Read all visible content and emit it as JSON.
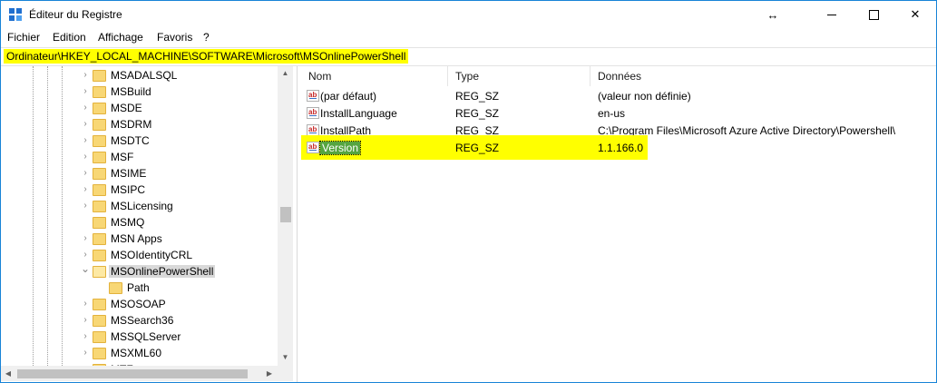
{
  "window": {
    "title": "Éditeur du Registre",
    "controls": {
      "resize_glyph": "↔",
      "minimize": "—",
      "maximize": "☐",
      "close": "✕"
    }
  },
  "menu": [
    "Fichier",
    "Edition",
    "Affichage",
    "Favoris",
    "?"
  ],
  "address": "Ordinateur\\HKEY_LOCAL_MACHINE\\SOFTWARE\\Microsoft\\MSOnlinePowerShell",
  "tree": {
    "items": [
      {
        "label": "MSADALSQL",
        "expandable": true,
        "state": "collapsed"
      },
      {
        "label": "MSBuild",
        "expandable": true,
        "state": "collapsed"
      },
      {
        "label": "MSDE",
        "expandable": true,
        "state": "collapsed"
      },
      {
        "label": "MSDRM",
        "expandable": true,
        "state": "collapsed"
      },
      {
        "label": "MSDTC",
        "expandable": true,
        "state": "collapsed"
      },
      {
        "label": "MSF",
        "expandable": true,
        "state": "collapsed"
      },
      {
        "label": "MSIME",
        "expandable": true,
        "state": "collapsed"
      },
      {
        "label": "MSIPC",
        "expandable": true,
        "state": "collapsed"
      },
      {
        "label": "MSLicensing",
        "expandable": true,
        "state": "collapsed"
      },
      {
        "label": "MSMQ",
        "expandable": false,
        "state": "leaf"
      },
      {
        "label": "MSN Apps",
        "expandable": true,
        "state": "collapsed"
      },
      {
        "label": "MSOIdentityCRL",
        "expandable": true,
        "state": "collapsed"
      },
      {
        "label": "MSOnlinePowerShell",
        "expandable": true,
        "state": "expanded",
        "selected": true
      },
      {
        "label": "Path",
        "expandable": false,
        "state": "leaf",
        "child": true
      },
      {
        "label": "MSOSOAP",
        "expandable": true,
        "state": "collapsed"
      },
      {
        "label": "MSSearch36",
        "expandable": true,
        "state": "collapsed"
      },
      {
        "label": "MSSQLServer",
        "expandable": true,
        "state": "collapsed"
      },
      {
        "label": "MSXML60",
        "expandable": true,
        "state": "collapsed"
      },
      {
        "label": "MTF",
        "expandable": true,
        "state": "collapsed"
      }
    ]
  },
  "columns": {
    "name": "Nom",
    "type": "Type",
    "data": "Données"
  },
  "values": [
    {
      "name": "(par défaut)",
      "type": "REG_SZ",
      "data": "(valeur non définie)"
    },
    {
      "name": "InstallLanguage",
      "type": "REG_SZ",
      "data": "en-us"
    },
    {
      "name": "InstallPath",
      "type": "REG_SZ",
      "data": "C:\\Program Files\\Microsoft Azure Active Directory\\Powershell\\"
    },
    {
      "name": "Version",
      "type": "REG_SZ",
      "data": "1.1.166.0",
      "selected": true,
      "highlighted": true
    }
  ],
  "value_icon_text": "ab",
  "colors": {
    "highlight": "#ffff00",
    "selection": "#56a540",
    "tree_selection": "#d9d9d9",
    "border_accent": "#1883d7"
  }
}
